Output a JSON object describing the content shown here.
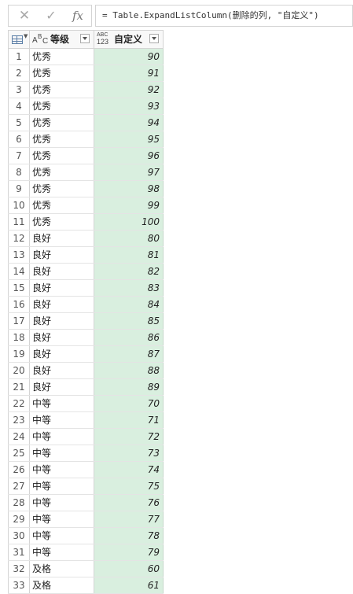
{
  "formula_bar": {
    "cancel_icon": "close-icon",
    "confirm_icon": "check-icon",
    "fx_label": "fx",
    "formula": "= Table.ExpandListColumn(删除的列, \"自定义\")"
  },
  "table": {
    "columns": [
      {
        "name": "等级",
        "type_icon": "text-type-icon",
        "type_label": "ABC"
      },
      {
        "name": "自定义",
        "type_icon": "any-type-icon",
        "type_label": "ABC 123",
        "selected": true,
        "color": "#d9efdf"
      }
    ],
    "rows": [
      {
        "n": "1",
        "grade": "优秀",
        "value": "90"
      },
      {
        "n": "2",
        "grade": "优秀",
        "value": "91"
      },
      {
        "n": "3",
        "grade": "优秀",
        "value": "92"
      },
      {
        "n": "4",
        "grade": "优秀",
        "value": "93"
      },
      {
        "n": "5",
        "grade": "优秀",
        "value": "94"
      },
      {
        "n": "6",
        "grade": "优秀",
        "value": "95"
      },
      {
        "n": "7",
        "grade": "优秀",
        "value": "96"
      },
      {
        "n": "8",
        "grade": "优秀",
        "value": "97"
      },
      {
        "n": "9",
        "grade": "优秀",
        "value": "98"
      },
      {
        "n": "10",
        "grade": "优秀",
        "value": "99"
      },
      {
        "n": "11",
        "grade": "优秀",
        "value": "100"
      },
      {
        "n": "12",
        "grade": "良好",
        "value": "80"
      },
      {
        "n": "13",
        "grade": "良好",
        "value": "81"
      },
      {
        "n": "14",
        "grade": "良好",
        "value": "82"
      },
      {
        "n": "15",
        "grade": "良好",
        "value": "83"
      },
      {
        "n": "16",
        "grade": "良好",
        "value": "84"
      },
      {
        "n": "17",
        "grade": "良好",
        "value": "85"
      },
      {
        "n": "18",
        "grade": "良好",
        "value": "86"
      },
      {
        "n": "19",
        "grade": "良好",
        "value": "87"
      },
      {
        "n": "20",
        "grade": "良好",
        "value": "88"
      },
      {
        "n": "21",
        "grade": "良好",
        "value": "89"
      },
      {
        "n": "22",
        "grade": "中等",
        "value": "70"
      },
      {
        "n": "23",
        "grade": "中等",
        "value": "71"
      },
      {
        "n": "24",
        "grade": "中等",
        "value": "72"
      },
      {
        "n": "25",
        "grade": "中等",
        "value": "73"
      },
      {
        "n": "26",
        "grade": "中等",
        "value": "74"
      },
      {
        "n": "27",
        "grade": "中等",
        "value": "75"
      },
      {
        "n": "28",
        "grade": "中等",
        "value": "76"
      },
      {
        "n": "29",
        "grade": "中等",
        "value": "77"
      },
      {
        "n": "30",
        "grade": "中等",
        "value": "78"
      },
      {
        "n": "31",
        "grade": "中等",
        "value": "79"
      },
      {
        "n": "32",
        "grade": "及格",
        "value": "60"
      },
      {
        "n": "33",
        "grade": "及格",
        "value": "61"
      }
    ]
  }
}
